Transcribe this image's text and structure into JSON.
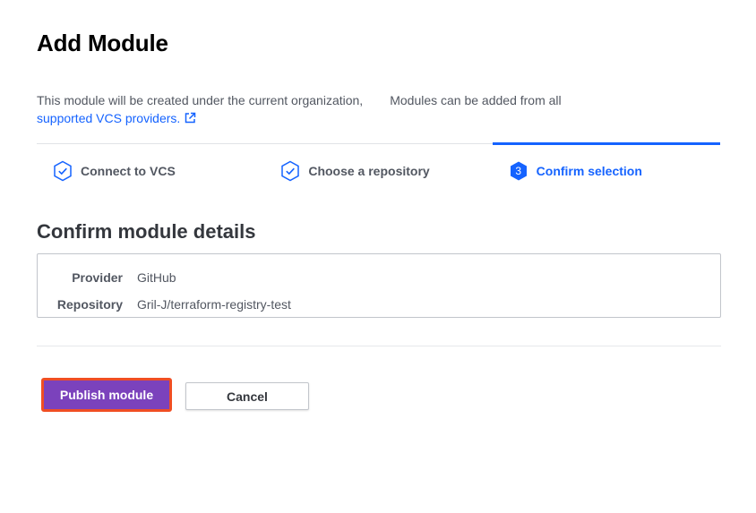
{
  "page": {
    "title": "Add Module"
  },
  "intro": {
    "text_part1": "This module will be created under the current organization,",
    "text_part2": "Modules can be added from all",
    "link_text": "supported VCS providers."
  },
  "steps": [
    {
      "label": "Connect to VCS",
      "state": "complete",
      "icon": "check-hexagon-icon"
    },
    {
      "label": "Choose a repository",
      "state": "complete",
      "icon": "check-hexagon-icon"
    },
    {
      "label": "Confirm selection",
      "state": "active",
      "number": "3",
      "icon": "number-hexagon-icon"
    }
  ],
  "details": {
    "title": "Confirm module details",
    "rows": [
      {
        "label": "Provider",
        "value": "GitHub"
      },
      {
        "label": "Repository",
        "value": "Gril-J/terraform-registry-test"
      }
    ]
  },
  "actions": {
    "publish_label": "Publish module",
    "cancel_label": "Cancel"
  },
  "colors": {
    "accent_blue": "#1563ff",
    "publish_purple": "#7b42bc",
    "highlight_border": "#f04e23"
  }
}
